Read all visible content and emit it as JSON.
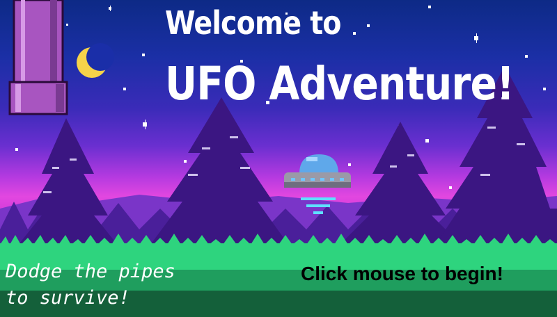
{
  "title": {
    "line1": "Welcome to",
    "line2": "UFO Adventure!"
  },
  "instructions": {
    "line1": "Dodge the pipes",
    "line2": "to survive!"
  },
  "prompt": "Click mouse to begin!",
  "sprites": {
    "player": "ufo",
    "obstacle": "pipe",
    "moon": "crescent-moon"
  },
  "colors": {
    "sky_top": "#0d2a86",
    "sky_glow": "#e247e0",
    "trees": "#3b1682",
    "grass": "#2ed47e",
    "pipe": "#b25ac8",
    "ufo_dome": "#5fa8ea",
    "ufo_body": "#9a9aa8",
    "moon": "#f5d34a"
  }
}
